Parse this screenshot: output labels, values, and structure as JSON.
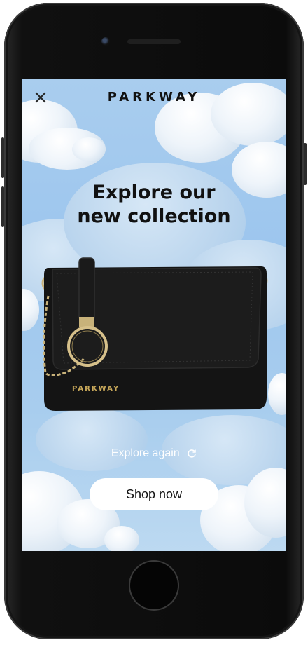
{
  "header": {
    "brand": "PARKWAY",
    "close_icon": "close-icon"
  },
  "hero": {
    "headline_line1": "Explore our",
    "headline_line2": "new collection"
  },
  "product": {
    "image": "black-leather-handbag",
    "logo_text": "PARKWAY"
  },
  "actions": {
    "explore_again_label": "Explore again",
    "explore_again_icon": "refresh-icon",
    "shop_label": "Shop now"
  },
  "colors": {
    "sky": "#a9cdee",
    "text": "#111111",
    "button_bg": "#ffffff",
    "bag": "#151515",
    "hardware": "#c8b27a"
  }
}
